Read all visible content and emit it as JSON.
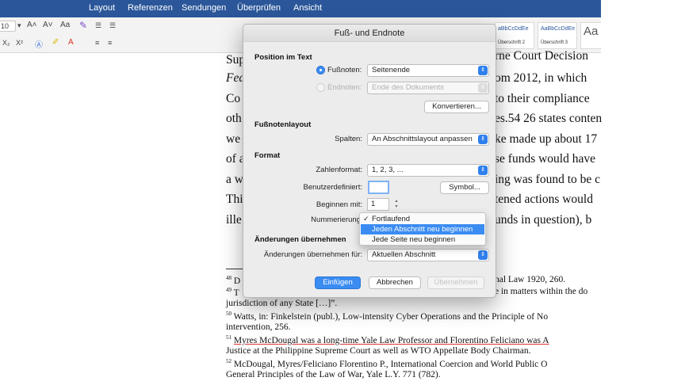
{
  "ribbon_tabs": [
    "Layout",
    "Referenzen",
    "Sendungen",
    "Überprüfen",
    "Ansicht"
  ],
  "ribbon": {
    "font_size": "10",
    "styles": [
      {
        "preview": "aBbCcDdEe",
        "label": "Überschrift 2"
      },
      {
        "preview": "AaBbCcDdEe",
        "label": "Überschrift 3"
      },
      {
        "preview": "Aa",
        "label": ""
      }
    ]
  },
  "document": {
    "right_lines": [
      "rne Court Decision",
      "om 2012, in which",
      "to their compliance",
      "es.54 26 states conten",
      "ke made up about 17",
      "se funds would have",
      "ing was found to be c",
      "tened actions would",
      "unds in question), b"
    ],
    "left_lines": [
      "Sup",
      "Fed",
      "Co",
      "oth",
      "we",
      "of a",
      "a w",
      "Thi",
      "ille"
    ],
    "footnotes": [
      {
        "num": "48",
        "pre": "D",
        "post": "nal Law 1920, 260."
      },
      {
        "num": "49",
        "pre": "T",
        "post": "e in matters within the do"
      },
      {
        "num": "",
        "pre": "jurisdiction of any State […]”.",
        "post": ""
      },
      {
        "num": "50",
        "pre": "Watts, in: Finkelstein (publ.), Low-intensity Cyber Operations and the Principle of No",
        "post": ""
      },
      {
        "num": "",
        "pre": "intervention, 256.",
        "post": ""
      },
      {
        "num": "51",
        "pre": "Myres McDougal was a long-time Yale Law Professor and Florentino Feliciano was A",
        "post": ""
      },
      {
        "num": "",
        "pre": "Justice at the Philippine Supreme Court as well as WTO Appellate Body Chairman.",
        "post": ""
      },
      {
        "num": "52",
        "pre": "McDougal, Myres/Feliciano Florentino P., International Coercion and World Public O",
        "post": ""
      },
      {
        "num": "",
        "pre": "General Principles of the Law of War, Yale L.Y. 771 (782).",
        "post": ""
      }
    ]
  },
  "dialog": {
    "title": "Fuß- und Endnote",
    "position_section": "Position im Text",
    "footnotes_label": "Fußnoten:",
    "footnotes_value": "Seitenende",
    "endnotes_label": "Endnoten:",
    "endnotes_value": "Ende des Dokuments",
    "convert_button": "Konvertieren...",
    "layout_section": "Fußnotenlayout",
    "columns_label": "Spalten:",
    "columns_value": "An Abschnittslayout anpassen",
    "format_section": "Format",
    "number_format_label": "Zahlenformat:",
    "number_format_value": "1, 2, 3, ...",
    "custom_label": "Benutzerdefiniert:",
    "custom_value": "",
    "symbol_button": "Symbol...",
    "start_label": "Beginnen mit:",
    "start_value": "1",
    "numbering_label": "Nummerierung",
    "apply_section": "Änderungen übernehmen",
    "apply_label": "Änderungen übernehmen für:",
    "apply_value": "Aktuellen Abschnitt",
    "insert_button": "Einfügen",
    "cancel_button": "Abbrechen",
    "apply_button": "Übernehmen"
  },
  "numbering_menu": {
    "items": [
      "Fortlaufend",
      "Jeden Abschnitt neu beginnen",
      "Jede Seite neu beginnen"
    ],
    "checked_index": 0,
    "highlighted_index": 1
  },
  "colors": {
    "ribbon_blue": "#2b579a",
    "accent": "#3b8cf2"
  }
}
